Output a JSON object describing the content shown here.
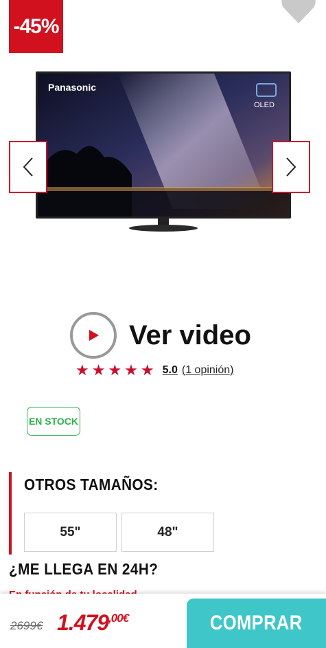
{
  "product": {
    "discount": "-45%",
    "brand": "Panasonic",
    "panel_badge": "OLED"
  },
  "media": {
    "video_label": "Ver video"
  },
  "rating": {
    "stars": "★★★★★",
    "value": "5.0",
    "count_label": "(1 opinión)"
  },
  "stock": {
    "label": "EN STOCK"
  },
  "sizes": {
    "title": "OTROS TAMAÑOS:",
    "options": [
      "55\"",
      "48\""
    ]
  },
  "delivery": {
    "title": "¿ME LLEGA EN 24H?",
    "text": "En función de tu localidad..."
  },
  "pricing": {
    "old_price": "2699€",
    "new_price": "1.479",
    "new_price_cents": ",00€"
  },
  "actions": {
    "buy_label": "COMPRAR"
  },
  "colors": {
    "accent": "#d2111e",
    "stock_green": "#2bb24c",
    "buy_button": "#3ec6c9"
  }
}
